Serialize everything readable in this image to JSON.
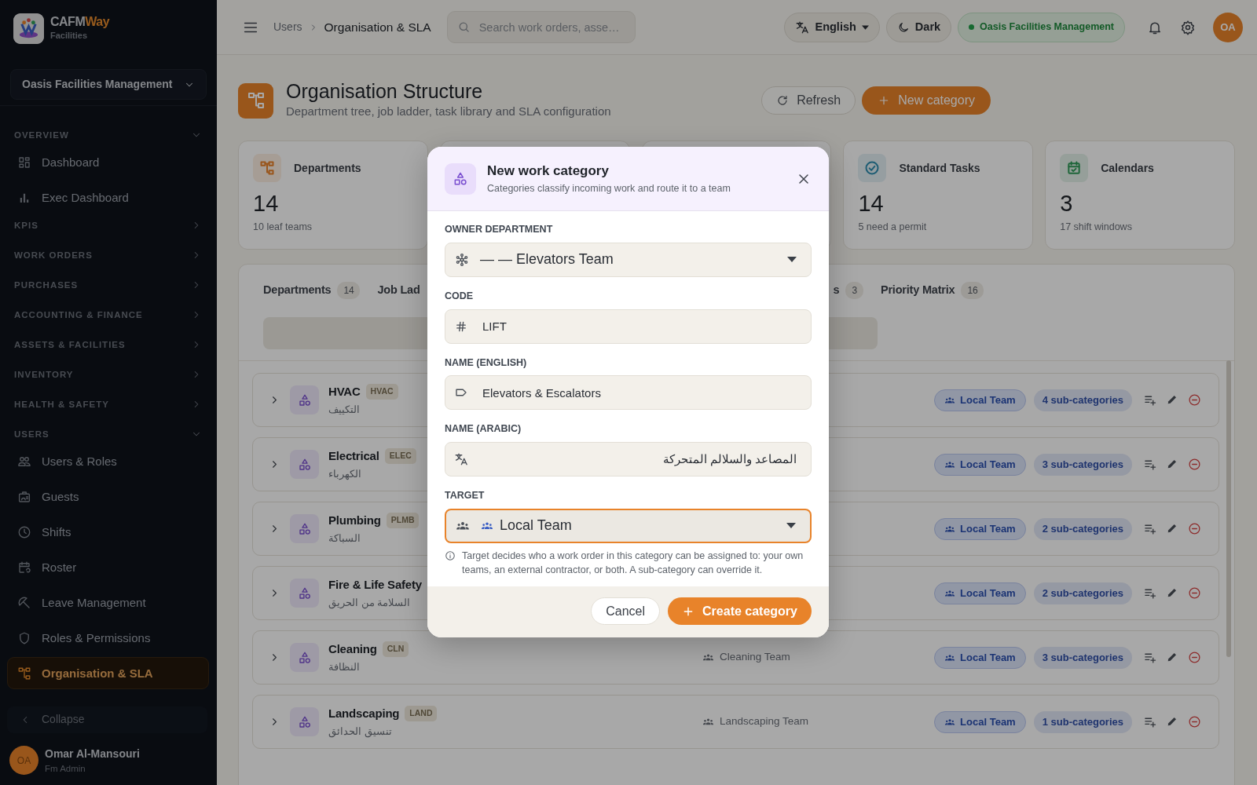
{
  "sidebar": {
    "brand": {
      "name": "CAFM",
      "accent": "Way",
      "subtitle": "Facilities"
    },
    "org_select": "Oasis Facilities Management",
    "sections": [
      {
        "label": "OVERVIEW",
        "expanded": true,
        "items": [
          {
            "label": "Dashboard",
            "selected": false
          },
          {
            "label": "Exec Dashboard",
            "selected": false
          }
        ]
      },
      {
        "label": "KPIS",
        "expanded": false
      },
      {
        "label": "WORK ORDERS",
        "expanded": false
      },
      {
        "label": "PURCHASES",
        "expanded": false
      },
      {
        "label": "ACCOUNTING & FINANCE",
        "expanded": false
      },
      {
        "label": "ASSETS & FACILITIES",
        "expanded": false
      },
      {
        "label": "INVENTORY",
        "expanded": false
      },
      {
        "label": "HEALTH & SAFETY",
        "expanded": false
      },
      {
        "label": "USERS",
        "expanded": true,
        "items": [
          {
            "label": "Users & Roles",
            "selected": false
          },
          {
            "label": "Guests",
            "selected": false
          },
          {
            "label": "Shifts",
            "selected": false
          },
          {
            "label": "Roster",
            "selected": false
          },
          {
            "label": "Leave Management",
            "selected": false
          },
          {
            "label": "Roles & Permissions",
            "selected": false
          },
          {
            "label": "Organisation & SLA",
            "selected": true
          }
        ]
      }
    ],
    "collapse": "Collapse",
    "user": {
      "initials": "OA",
      "name": "Omar Al-Mansouri",
      "role": "Fm Admin"
    }
  },
  "topbar": {
    "breadcrumb": [
      "Users",
      "Organisation & SLA"
    ],
    "search": {
      "placeholder": "Search work orders, asse…"
    },
    "language": "English",
    "theme": "Dark",
    "org": "Oasis Facilities Management",
    "avatar": "OA"
  },
  "header": {
    "title": "Organisation Structure",
    "subtitle": "Department tree, job ladder, task library and SLA configuration",
    "buttons": [
      {
        "label": "Refresh",
        "kind": "outline"
      },
      {
        "label": "New category",
        "kind": "primary"
      }
    ]
  },
  "stats": [
    {
      "kind": "card",
      "label": "Departments",
      "value": "14",
      "note": "10 leaf teams",
      "color": "#99561c"
    },
    {
      "kind": "covered"
    },
    {
      "kind": "covered"
    },
    {
      "kind": "card",
      "label": "Standard Tasks",
      "value": "14",
      "note": "5 need a permit",
      "color": "#1f5e74"
    },
    {
      "kind": "card",
      "label": "Calendars",
      "value": "3",
      "note": "17 shift windows",
      "color": "#1f663b"
    }
  ],
  "tabs": [
    {
      "kind": "tab",
      "label": "Departments",
      "count": "14",
      "selected": false
    },
    {
      "kind": "tab",
      "label": "Job Lad",
      "selected": false
    },
    {
      "kind": "covered"
    },
    {
      "kind": "tab",
      "label": "s",
      "count": "3",
      "selected": false
    },
    {
      "kind": "tab",
      "label": "Priority Matrix",
      "count": "16",
      "selected": false
    }
  ],
  "categories": [
    {
      "name": "HVAC",
      "code": "HVAC",
      "arabic": "التكييف",
      "target": "Local Team",
      "subcategories": "4 sub-categories"
    },
    {
      "name": "Electrical",
      "code": "ELEC",
      "arabic": "الكهرباء",
      "target": "Local Team",
      "subcategories": "3 sub-categories"
    },
    {
      "name": "Plumbing",
      "code": "PLMB",
      "arabic": "السباكة",
      "target": "Local Team",
      "subcategories": "2 sub-categories"
    },
    {
      "name": "Fire & Life Safety",
      "arabic": "السلامة من الحريق",
      "target": "Local Team",
      "subcategories": "2 sub-categories"
    },
    {
      "name": "Cleaning",
      "code": "CLN",
      "arabic": "النظافة",
      "team": "Cleaning Team",
      "target": "Local Team",
      "subcategories": "3 sub-categories"
    },
    {
      "name": "Landscaping",
      "code": "LAND",
      "arabic": "تنسيق الحدائق",
      "team": "Landscaping Team",
      "target": "Local Team",
      "subcategories": "1 sub-categories"
    }
  ],
  "modal": {
    "title": "New work category",
    "subtitle": "Categories classify incoming work and route it to a team",
    "fields": [
      {
        "label": "OWNER DEPARTMENT",
        "kind": "select",
        "value": "— — Elevators Team",
        "focused": false
      },
      {
        "label": "CODE",
        "kind": "input",
        "value": "LIFT",
        "focused": false
      },
      {
        "label": "NAME (ENGLISH)",
        "kind": "input",
        "value": "Elevators & Escalators",
        "focused": false
      },
      {
        "label": "NAME (ARABIC)",
        "kind": "input",
        "value": "المصاعد والسلالم المتحركة",
        "focused": false
      },
      {
        "label": "TARGET",
        "kind": "select",
        "value": "Local Team",
        "focused": true
      }
    ],
    "hint": "Target decides who a work order in this category can be assigned to: your own teams, an external contractor, or both. A sub-category can override it.",
    "buttons": [
      {
        "label": "Cancel",
        "kind": "secondary"
      },
      {
        "label": "Create category",
        "kind": "primary"
      }
    ]
  }
}
